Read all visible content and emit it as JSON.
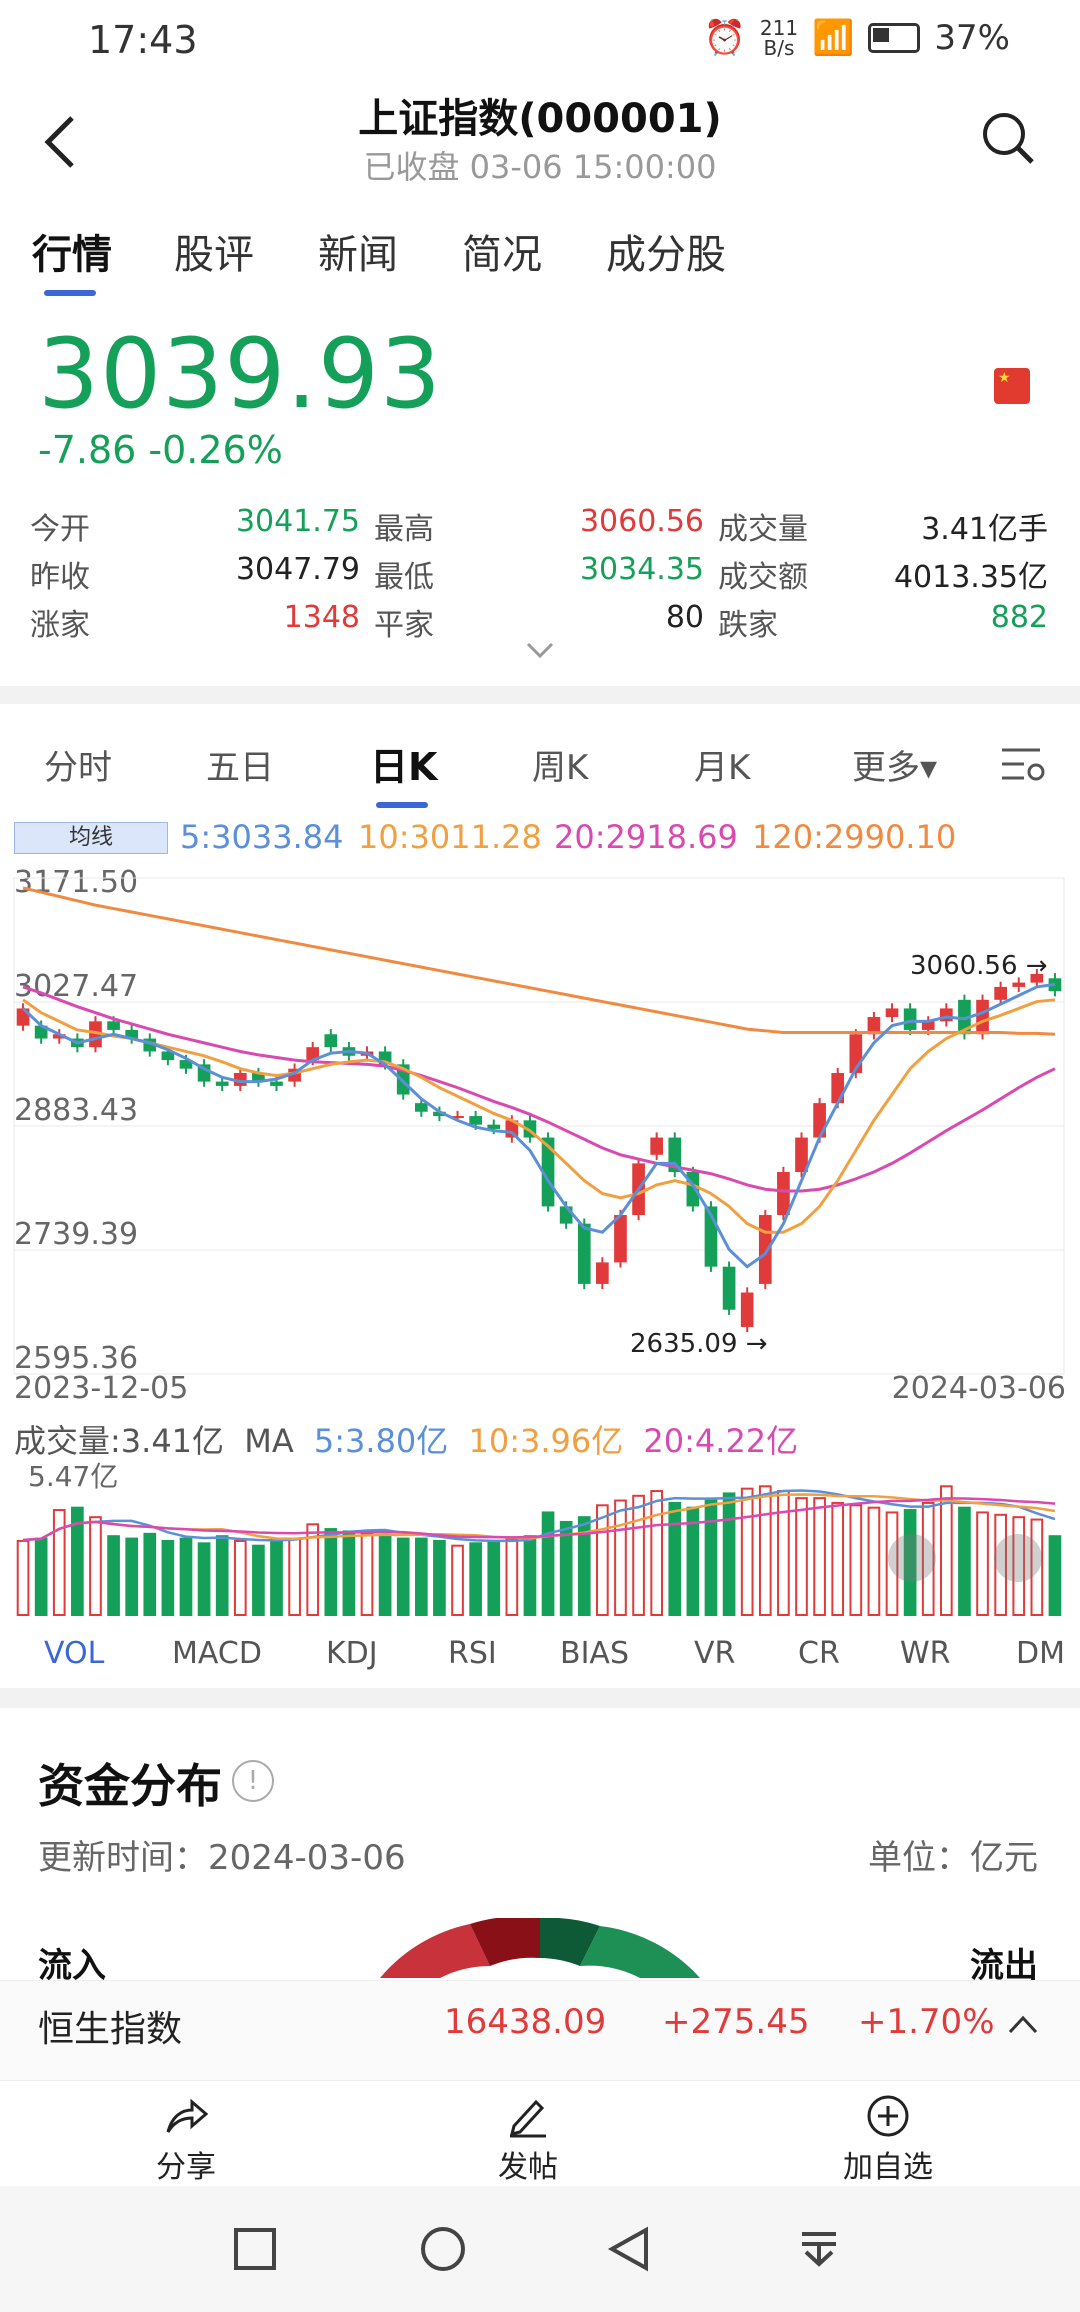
{
  "status": {
    "time": "17:43",
    "speed": "211\nB/s",
    "battery": "37%"
  },
  "header": {
    "title": "上证指数(000001)",
    "subtitle": "已收盘  03-06 15:00:00"
  },
  "tabs": [
    "行情",
    "股评",
    "新闻",
    "简况",
    "成分股"
  ],
  "quote": {
    "price": "3039.93",
    "change": "-7.86 -0.26%"
  },
  "stats": [
    [
      {
        "label": "今开",
        "value": "3041.75",
        "color": "#15a05a"
      },
      {
        "label": "最高",
        "value": "3060.56",
        "color": "#e03a3a"
      },
      {
        "label": "成交量",
        "value": "3.41亿手",
        "color": "#222"
      }
    ],
    [
      {
        "label": "昨收",
        "value": "3047.79",
        "color": "#222"
      },
      {
        "label": "最低",
        "value": "3034.35",
        "color": "#15a05a"
      },
      {
        "label": "成交额",
        "value": "4013.35亿",
        "color": "#222"
      }
    ],
    [
      {
        "label": "涨家",
        "value": "1348",
        "color": "#e03a3a"
      },
      {
        "label": "平家",
        "value": "80",
        "color": "#222"
      },
      {
        "label": "跌家",
        "value": "882",
        "color": "#15a05a"
      }
    ]
  ],
  "period_tabs": [
    "分时",
    "五日",
    "日K",
    "周K",
    "月K",
    "更多▾"
  ],
  "ma": {
    "badge": "均线",
    "ma5": "5:3033.84",
    "ma10": "10:3011.28",
    "ma20": "20:2918.69",
    "ma120": "120:2990.10"
  },
  "chart_data": {
    "type": "candlestick",
    "y_ticks": [
      "3171.50",
      "3027.47",
      "2883.43",
      "2739.39",
      "2595.36"
    ],
    "ylim": [
      2595.36,
      3171.5
    ],
    "x_start": "2023-12-05",
    "x_end": "2024-03-06",
    "annotations": {
      "high": "3060.56",
      "low": "2635.09"
    },
    "closes": [
      3020,
      2985,
      2990,
      2975,
      3005,
      2995,
      2985,
      2970,
      2960,
      2950,
      2935,
      2930,
      2945,
      2935,
      2930,
      2950,
      2975,
      2975,
      2965,
      2970,
      2955,
      2920,
      2900,
      2895,
      2895,
      2885,
      2880,
      2890,
      2870,
      2790,
      2770,
      2700,
      2725,
      2780,
      2840,
      2870,
      2830,
      2790,
      2720,
      2670,
      2690,
      2780,
      2830,
      2870,
      2910,
      2945,
      2990,
      3010,
      3020,
      2995,
      3005,
      3020,
      2990,
      3030,
      3045,
      3050,
      3060,
      3040
    ],
    "opens": [
      3000,
      3000,
      2985,
      2985,
      2975,
      3005,
      2995,
      2985,
      2970,
      2960,
      2955,
      2935,
      2930,
      2945,
      2935,
      2935,
      2960,
      2990,
      2975,
      2965,
      2970,
      2955,
      2910,
      2900,
      2895,
      2895,
      2885,
      2870,
      2890,
      2870,
      2790,
      2770,
      2700,
      2725,
      2780,
      2850,
      2870,
      2830,
      2790,
      2720,
      2650,
      2700,
      2780,
      2830,
      2870,
      2910,
      2945,
      2990,
      3010,
      3020,
      2995,
      3005,
      3030,
      2990,
      3030,
      3045,
      3050,
      3055
    ],
    "ma5": [
      3020,
      3000,
      2990,
      2980,
      2985,
      2990,
      2985,
      2980,
      2972,
      2962,
      2950,
      2940,
      2935,
      2935,
      2938,
      2945,
      2960,
      2968,
      2970,
      2968,
      2955,
      2935,
      2915,
      2900,
      2890,
      2882,
      2878,
      2876,
      2855,
      2820,
      2790,
      2765,
      2760,
      2780,
      2810,
      2840,
      2840,
      2815,
      2780,
      2740,
      2720,
      2735,
      2770,
      2820,
      2870,
      2910,
      2950,
      2980,
      3000,
      3005,
      3005,
      3010,
      3008,
      3015,
      3025,
      3035,
      3045,
      3048
    ],
    "ma10": [
      3030,
      3015,
      3005,
      2995,
      2992,
      2988,
      2985,
      2980,
      2975,
      2970,
      2965,
      2958,
      2950,
      2945,
      2942,
      2945,
      2950,
      2955,
      2958,
      2960,
      2958,
      2950,
      2940,
      2928,
      2918,
      2908,
      2898,
      2890,
      2878,
      2860,
      2840,
      2820,
      2805,
      2800,
      2805,
      2815,
      2820,
      2815,
      2805,
      2790,
      2770,
      2760,
      2760,
      2770,
      2790,
      2820,
      2855,
      2890,
      2920,
      2950,
      2970,
      2985,
      2995,
      3005,
      3012,
      3020,
      3028,
      3030
    ],
    "ma20": [
      3045,
      3038,
      3030,
      3022,
      3015,
      3008,
      3002,
      2996,
      2990,
      2985,
      2980,
      2975,
      2970,
      2966,
      2963,
      2960,
      2958,
      2957,
      2956,
      2955,
      2953,
      2948,
      2942,
      2935,
      2928,
      2920,
      2912,
      2905,
      2897,
      2888,
      2878,
      2868,
      2858,
      2850,
      2845,
      2840,
      2836,
      2832,
      2828,
      2822,
      2815,
      2810,
      2808,
      2808,
      2810,
      2815,
      2822,
      2830,
      2840,
      2852,
      2865,
      2878,
      2890,
      2902,
      2915,
      2928,
      2940,
      2950
    ],
    "ma120": [
      3160,
      3155,
      3150,
      3145,
      3140,
      3136,
      3132,
      3128,
      3124,
      3120,
      3116,
      3112,
      3108,
      3104,
      3100,
      3096,
      3092,
      3088,
      3084,
      3080,
      3076,
      3072,
      3068,
      3064,
      3060,
      3056,
      3052,
      3048,
      3044,
      3040,
      3036,
      3032,
      3028,
      3024,
      3020,
      3016,
      3012,
      3008,
      3004,
      3000,
      2996,
      2994,
      2992,
      2992,
      2992,
      2992,
      2992,
      2992,
      2992,
      2992,
      2992,
      2992,
      2992,
      2992,
      2992,
      2991,
      2991,
      2990
    ]
  },
  "volume": {
    "header_total": "成交量:3.41亿",
    "header_ma": "MA",
    "ma5": "5:3.80亿",
    "ma10": "10:3.96亿",
    "ma20": "20:4.22亿",
    "max": "5.47亿",
    "values": [
      3.2,
      3.3,
      4.5,
      4.6,
      4.2,
      3.4,
      3.3,
      3.5,
      3.2,
      3.3,
      3.1,
      3.4,
      3.2,
      3.0,
      3.2,
      3.3,
      3.9,
      3.7,
      3.6,
      3.5,
      3.4,
      3.3,
      3.3,
      3.2,
      3.0,
      3.1,
      3.2,
      3.3,
      3.4,
      4.4,
      4.0,
      4.2,
      4.7,
      4.9,
      5.1,
      5.3,
      4.8,
      4.6,
      4.9,
      5.2,
      5.4,
      5.5,
      5.3,
      5.0,
      5.0,
      4.8,
      4.7,
      4.6,
      4.4,
      4.5,
      4.8,
      5.5,
      4.6,
      4.4,
      4.3,
      4.2,
      4.1,
      3.4
    ]
  },
  "indicators": [
    "VOL",
    "MACD",
    "KDJ",
    "RSI",
    "BIAS",
    "VR",
    "CR",
    "WR",
    "DM"
  ],
  "fund": {
    "title": "资金分布",
    "update": "更新时间：2024-03-06",
    "unit": "单位：亿元",
    "in": "流入",
    "out": "流出"
  },
  "ticker": {
    "name": "恒生指数",
    "value": "16438.09",
    "change": "+275.45",
    "pct": "+1.70%"
  },
  "bottom": {
    "share": "分享",
    "post": "发帖",
    "add": "加自选"
  },
  "colors": {
    "up": "#e03a3a",
    "down": "#15a05a",
    "ma5": "#5b8fd8",
    "ma10": "#f0a040",
    "ma20": "#d84ab0",
    "ma120": "#f08a40"
  }
}
